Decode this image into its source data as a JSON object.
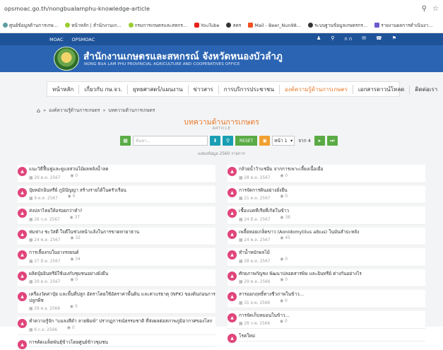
{
  "browser": {
    "url": "opsmoac.go.th/nongbualamphu-knowledge-article",
    "bookmarks": [
      {
        "label": "ศูนย์ข้อมูลด้านการเกษ...",
        "color": "#5f9ea0"
      },
      {
        "label": "หน้าหลัก | สำนักงานเก...",
        "color": "#9acd32"
      },
      {
        "label": "กรมการเกษตรและสหกร...",
        "color": "#9acd32"
      },
      {
        "label": "YouTube",
        "color": "#e62117"
      },
      {
        "label": "สคร",
        "color": "#333333"
      },
      {
        "label": "Mail - Beer_Nun98...",
        "color": "#f25022"
      },
      {
        "label": "ระบบฐานข้อมูลเกษตรกร...",
        "color": "#333333"
      },
      {
        "label": "รายงานผลการดำเนินงา...",
        "color": "#6a5acd"
      }
    ]
  },
  "header": {
    "top_links": [
      "MOAC",
      "OPSMOAC"
    ],
    "top_icons": [
      "ภ",
      "Q",
      "n ๑",
      "✉",
      "☎",
      "⚲"
    ],
    "title": "สำนักงานเกษตรและสหกรณ์ จังหวัดหนองบัวลำภู",
    "subtitle": "NONG BUA LAM PHU PROVINCIAL AGRICULTURE AND COOPERATIVES OFFICE"
  },
  "nav": {
    "items": [
      {
        "label": "หน้าหลัก",
        "active": false
      },
      {
        "label": "เกี่ยวกับ กษ.จว.",
        "active": false
      },
      {
        "label": "ยุทธศาสตร์/แผนงาน",
        "active": false
      },
      {
        "label": "ข่าวสาร",
        "active": false
      },
      {
        "label": "การบริการประชาชน",
        "active": false
      },
      {
        "label": "องค์ความรู้ด้านการเกษตร",
        "active": true
      },
      {
        "label": "เอกสารดาวน์โหลด",
        "active": false
      },
      {
        "label": "ติดต่อเรา",
        "active": false
      }
    ]
  },
  "breadcrumb": {
    "level1": "องค์ความรู้ด้านการเกษตร",
    "level2": "บทความด้านการเกษตร"
  },
  "page": {
    "title": "บทความด้านการเกษตร",
    "subtitle": "ARTICLE",
    "count_text": "แสดงข้อมูล 2560 รายการ"
  },
  "toolbar": {
    "search_placeholder": "ค้นหา...",
    "reset_label": "RESET",
    "page_select": "หน้า 1",
    "of_text": "จาก 4"
  },
  "articles_left": [
    {
      "title": "แนะวิธีฟื้นฟูและดูแลสวนไม้ผลหลังน้ำลด",
      "date": "29 ต.ค. 2567",
      "views": "0"
    },
    {
      "title": "ปุ๋ยหมักอินทรีย์ ภูมิปัญญา สร้างรายได้ในครัวเรือน",
      "date": "9 ต.ค. 2567",
      "views": "0"
    },
    {
      "title": "ส่งปลาไทยให้อร่อยกว่าทำ?",
      "date": "26 ก.ย. 2567",
      "views": "37"
    },
    {
      "title": "ห่มฟาง ชะวัสดี ใจดีในช่วงหน้าแล้งในการขาดหายาธาน",
      "date": "24 พ.ค. 2567",
      "views": "32"
    },
    {
      "title": "การเลี้ยงกบในยางรถยนต์",
      "date": "27 มี.ค. 2567",
      "views": "34"
    },
    {
      "title": "ผลิตปุ๋ยอินทรีย์ใช้เองกับชุมชนอย่างยั่งยืน",
      "date": "29 ต.ค. 2567",
      "views": "0"
    },
    {
      "title": "เครื่องวัดค่าปุ๋ย และพื้นที่ปลูก อัตราโดยใช้อัตราค่าพื้นดิน และค่าแร่ธาตุ (NPK) ของดินก่อนการปลูกพืช",
      "date": "29 พ.ย. 2566",
      "views": "0"
    },
    {
      "title": "ทำความรู้จัก \"แมลงสีดำ ลายพิมพ์\" ปรากฏการณ์ธรรมชาติ ที่ส่งผลต่อสภาพภูมิอากาศของโลก",
      "date": "6 ก.ย. 2566",
      "views": "0"
    },
    {
      "title": "การคัดเมล็ดพันธุ์ข้าวโดยศูนย์ข้าวชุมชน",
      "date": "",
      "views": ""
    }
  ],
  "articles_right": [
    {
      "title": "กล้วยน้ำว้าแช่อิ่ม จากการเพาะเลี้ยงเนื้อเยื่อ",
      "date": "28 ต.ค. 2567",
      "views": "0"
    },
    {
      "title": "การจัดการดินอย่างยั่งยืน",
      "date": "21 ต.ค. 2567",
      "views": "0"
    },
    {
      "title": "เชื้อแบคทีเรียที่เกิดในข้าว",
      "date": "24 มี.ค. 2567",
      "views": "38"
    },
    {
      "title": "เพลี้ยหอยเกล็ดขาว (Aonidomytilus albus) ในมันสำปะหลัง",
      "date": "24 พ.ค. 2567",
      "views": "45"
    },
    {
      "title": "ทำน้ำหมักผลไม้",
      "date": "28 ต.ค. 2567",
      "views": "0"
    },
    {
      "title": "ศักยภาพกัญชง พัฒนาปลอดสารพิษ และอินทรีย์ ต่างกันอย่างไร",
      "date": "29 พ.ค. 2566",
      "views": "0"
    },
    {
      "title": "สารออกฤทธิ์ทางชีวภาพในข้าว...",
      "date": "31 ส.ค. 2566",
      "views": "0"
    },
    {
      "title": "การจัดเก็บหมอนในข้าว...",
      "date": "28 ก.พ. 2566",
      "views": "0"
    },
    {
      "title": "โรคใหม่",
      "date": "",
      "views": ""
    }
  ],
  "colors": {
    "header_blue": "#2a64b3",
    "strip_blue": "#1f5399",
    "accent_orange": "#e8792a",
    "avatar_pink": "#e0457b",
    "green_button": "#5aab45",
    "teal_button": "#199fb4"
  }
}
